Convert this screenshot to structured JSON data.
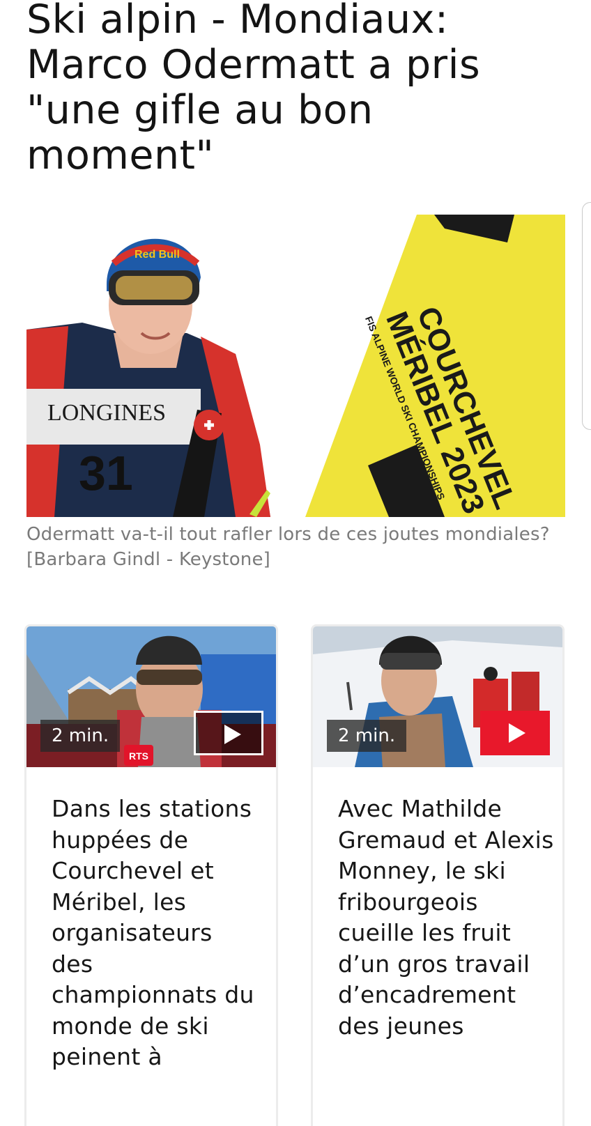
{
  "article": {
    "headline": "Ski alpin - Mondiaux: Marco Odermatt a pris \"une gifle au bon moment\"",
    "hero_image": {
      "description_icon": "photo-skier-courchevel",
      "banner_lines": [
        "COURCHEVEL",
        "MÉRIBEL 2023",
        "FIS ALPINE WORLD SKI CHAMPIONSHIPS"
      ],
      "bib_number": "31",
      "bib_sponsor": "LONGINES",
      "helmet_sponsor": "Red Bull"
    },
    "caption": "Odermatt va-t-il tout rafler lors de ces joutes mondiales? [Barbara Gindl - Keystone]"
  },
  "related": [
    {
      "duration": "2 min.",
      "title": "Dans les stations huppées de Courchevel et Méribel, les organisateurs des championnats du monde de ski peinent à",
      "play_style": "outline",
      "thumb_badge": "RTS"
    },
    {
      "duration": "2 min.",
      "title": "Avec Mathilde Gremaud et Alexis Monney, le ski fribourgeois cueille les fruit d’un gros travail d’encadrement des jeunes",
      "play_style": "filled"
    }
  ],
  "colors": {
    "play_red": "#e8182b",
    "banner_yellow": "#efe33a",
    "caption_gray": "#7a7a7a"
  }
}
